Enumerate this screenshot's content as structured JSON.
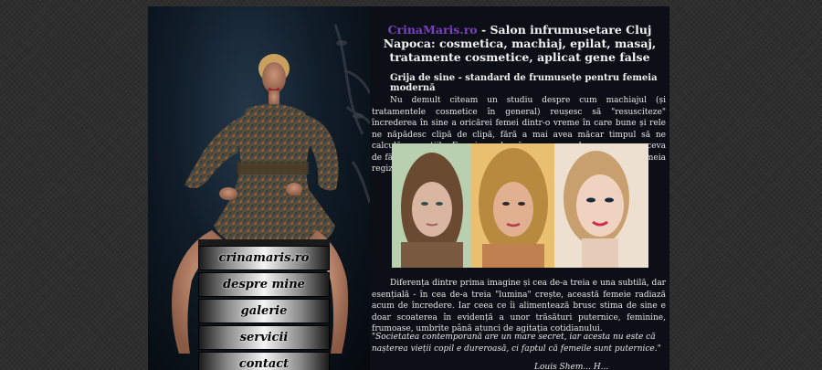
{
  "header": {
    "site_name": "CrinaMaris.ro",
    "title_rest": " - Salon infrumusetare Cluj Napoca: cosmetica, machiaj, epilat, masaj, tratamente cosmetice, aplicat gene false"
  },
  "article": {
    "title": "Grija de sine - standard de frumusețe pentru femeia modernă",
    "paragraph1": "Nu demult citeam un studiu despre cum machiajul (și tratamentele cosmetice în general) reușesc să \"resusciteze\" încrederea în sine a oricărei femei dintr-o vreme în care bune și rele ne năpădesc clipă de clipă, fără a mai avea măcar timpul să ne calculăm reacțiile. Femeia modernă e mereu pe drum, mereu cu ceva de făcut, într-o lume în care bărbații sunt actori principali, iar femeia regizorul.",
    "paragraph2": "Diferența dintre prima imagine și cea de-a treia e una subtilă, dar esențială - în cea de-a treia \"lumina\" crește, această femeie radiază acum de încredere. Iar ceea ce îi alimentează brusc stima de sine e doar scoaterea în evidență a unor trăsături puternice, feminine, frumoase, umbrite până atunci de agitația cotidianului.",
    "quote": "\"Societatea contemporană are un mare secret, iar acesta nu este că nașterea vieții copil e dureroasă, ci faptul că femeile sunt puternice.\"",
    "signature": "Louis Shem... H..."
  },
  "nav": {
    "items": [
      "crinamaris.ro",
      "despre mine",
      "galerie",
      "servicii",
      "contact"
    ]
  },
  "colors": {
    "site_link": "#7a3fc2",
    "page_bg": "#0c1016",
    "body_bg": "#2e2e2e"
  }
}
